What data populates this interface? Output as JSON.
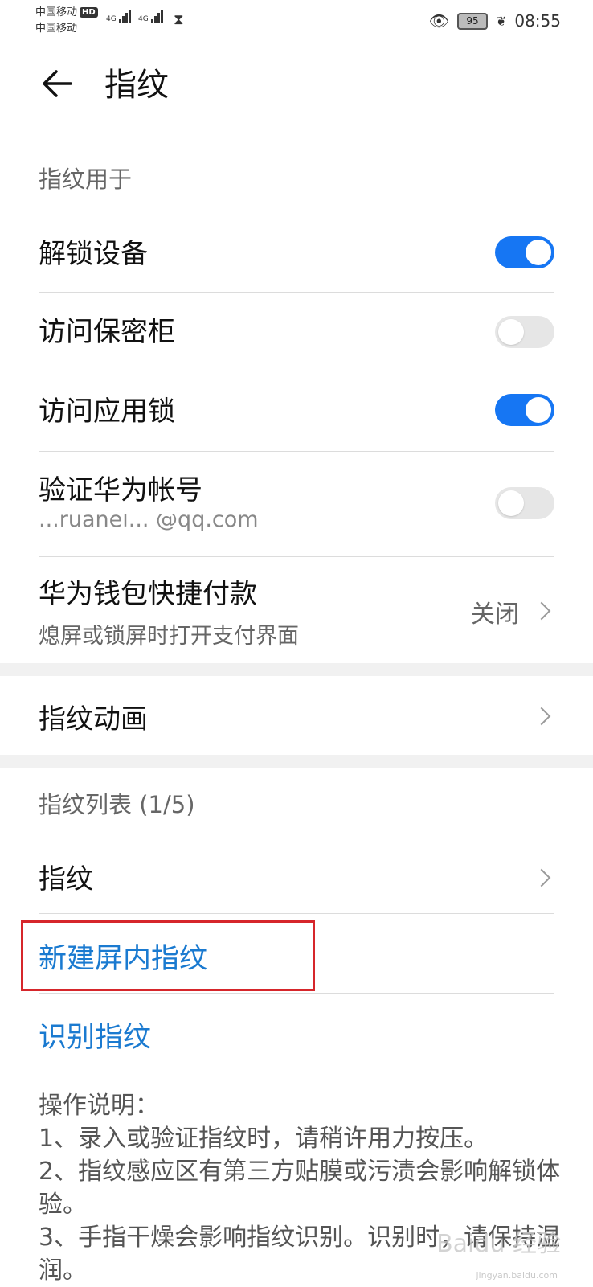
{
  "status_bar": {
    "carrier1": "中国移动",
    "carrier1_badge": "HD",
    "carrier2": "中国移动",
    "net1": "4G",
    "net2": "4G",
    "battery": "95",
    "time": "08:55"
  },
  "header": {
    "title": "指纹"
  },
  "usage": {
    "section_label": "指纹用于",
    "items": [
      {
        "label": "解锁设备",
        "toggle": "on"
      },
      {
        "label": "访问保密柜",
        "toggle": "off"
      },
      {
        "label": "访问应用锁",
        "toggle": "on"
      },
      {
        "label": "验证华为帐号",
        "sub": "...ruanel... @qq.com",
        "toggle": "off"
      }
    ],
    "wallet": {
      "label": "华为钱包快捷付款",
      "sub": "熄屏或锁屏时打开支付界面",
      "value": "关闭"
    }
  },
  "animation": {
    "label": "指纹动画"
  },
  "list": {
    "section_label": "指纹列表 (1/5)",
    "fingerprint": "指纹",
    "new_link": "新建屏内指纹",
    "identify_link": "识别指纹"
  },
  "instructions": {
    "heading": "操作说明：",
    "line1": "1、录入或验证指纹时，请稍许用力按压。",
    "line2": "2、指纹感应区有第三方贴膜或污渍会影响解锁体验。",
    "line3": "3、手指干燥会影响指纹识别。识别时，请保持湿润。"
  },
  "watermark": {
    "text": "Baidu 经验",
    "url": "jingyan.baidu.com"
  },
  "colors": {
    "accent": "#1676f3",
    "link": "#1a7ad0",
    "highlight_box": "#d6262b"
  }
}
